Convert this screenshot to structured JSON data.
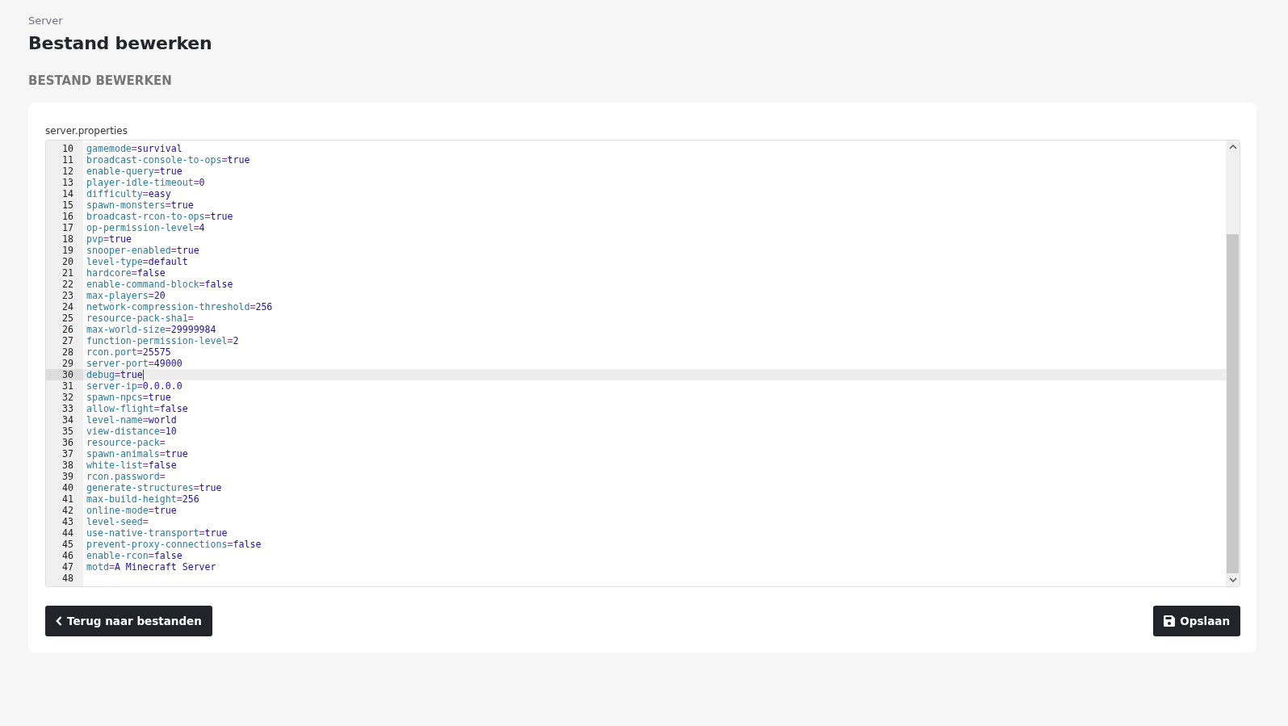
{
  "breadcrumb": "Server",
  "title": "Bestand bewerken",
  "section_heading": "BESTAND BEWERKEN",
  "editor": {
    "file_name": "server.properties",
    "lines": [
      {
        "number": "10",
        "text": "gamemode=survival",
        "current": false
      },
      {
        "number": "11",
        "text": "broadcast-console-to-ops=true",
        "current": false
      },
      {
        "number": "12",
        "text": "enable-query=true",
        "current": false
      },
      {
        "number": "13",
        "text": "player-idle-timeout=0",
        "current": false
      },
      {
        "number": "14",
        "text": "difficulty=easy",
        "current": false
      },
      {
        "number": "15",
        "text": "spawn-monsters=true",
        "current": false
      },
      {
        "number": "16",
        "text": "broadcast-rcon-to-ops=true",
        "current": false
      },
      {
        "number": "17",
        "text": "op-permission-level=4",
        "current": false
      },
      {
        "number": "18",
        "text": "pvp=true",
        "current": false
      },
      {
        "number": "19",
        "text": "snooper-enabled=true",
        "current": false
      },
      {
        "number": "20",
        "text": "level-type=default",
        "current": false
      },
      {
        "number": "21",
        "text": "hardcore=false",
        "current": false
      },
      {
        "number": "22",
        "text": "enable-command-block=false",
        "current": false
      },
      {
        "number": "23",
        "text": "max-players=20",
        "current": false
      },
      {
        "number": "24",
        "text": "network-compression-threshold=256",
        "current": false
      },
      {
        "number": "25",
        "text": "resource-pack-sha1=",
        "current": false
      },
      {
        "number": "26",
        "text": "max-world-size=29999984",
        "current": false
      },
      {
        "number": "27",
        "text": "function-permission-level=2",
        "current": false
      },
      {
        "number": "28",
        "text": "rcon.port=25575",
        "current": false
      },
      {
        "number": "29",
        "text": "server-port=49000",
        "current": false
      },
      {
        "number": "30",
        "text": "debug=true",
        "current": true
      },
      {
        "number": "31",
        "text": "server-ip=0.0.0.0",
        "current": false
      },
      {
        "number": "32",
        "text": "spawn-npcs=true",
        "current": false
      },
      {
        "number": "33",
        "text": "allow-flight=false",
        "current": false
      },
      {
        "number": "34",
        "text": "level-name=world",
        "current": false
      },
      {
        "number": "35",
        "text": "view-distance=10",
        "current": false
      },
      {
        "number": "36",
        "text": "resource-pack=",
        "current": false
      },
      {
        "number": "37",
        "text": "spawn-animals=true",
        "current": false
      },
      {
        "number": "38",
        "text": "white-list=false",
        "current": false
      },
      {
        "number": "39",
        "text": "rcon.password=",
        "current": false
      },
      {
        "number": "40",
        "text": "generate-structures=true",
        "current": false
      },
      {
        "number": "41",
        "text": "max-build-height=256",
        "current": false
      },
      {
        "number": "42",
        "text": "online-mode=true",
        "current": false
      },
      {
        "number": "43",
        "text": "level-seed=",
        "current": false
      },
      {
        "number": "44",
        "text": "use-native-transport=true",
        "current": false
      },
      {
        "number": "45",
        "text": "prevent-proxy-connections=false",
        "current": false
      },
      {
        "number": "46",
        "text": "enable-rcon=false",
        "current": false
      },
      {
        "number": "47",
        "text": "motd=A Minecraft Server",
        "current": false
      },
      {
        "number": "48",
        "current": false
      }
    ]
  },
  "buttons": [
    {
      "kind": "back",
      "label": "Terug naar bestanden"
    },
    {
      "kind": "save",
      "label": "Opslaan"
    }
  ]
}
